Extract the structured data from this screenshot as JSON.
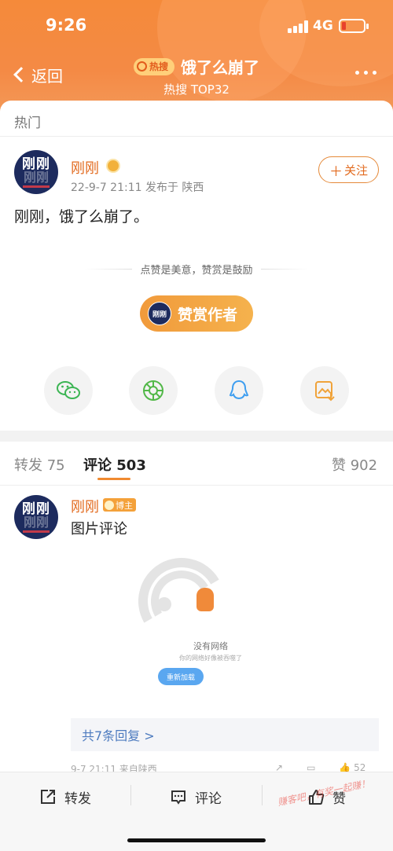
{
  "status_bar": {
    "time": "9:26",
    "network": "4G"
  },
  "nav": {
    "back_label": "返回",
    "hot_tag": "热搜",
    "title": "饿了么崩了",
    "subtitle": "热搜 TOP32"
  },
  "post": {
    "section_label": "热门",
    "avatar_text": "刚刚",
    "author": "刚刚",
    "meta": "22-9-7 21:11  发布于 陕西",
    "follow_label": "关注",
    "content": "刚刚，饿了么崩了。",
    "reward_hint": "点赞是美意，赞赏是鼓励",
    "reward_button": "赞赏作者",
    "share_icons": [
      "wechat-icon",
      "moments-icon",
      "qq-icon",
      "save-image-icon"
    ]
  },
  "tabs": {
    "repost": {
      "label": "转发",
      "count": "75"
    },
    "comment": {
      "label": "评论",
      "count": "503"
    },
    "like": {
      "label": "赞",
      "count": "902"
    }
  },
  "comment": {
    "avatar_text": "刚刚",
    "author": "刚刚",
    "badge": "博主",
    "text": "图片评论",
    "image": {
      "no_network": "没有网络",
      "no_network_sub": "你的网络好像被吞噬了",
      "reload": "重新加载"
    },
    "replies": "共7条回复 >",
    "meta": "9-7 21:11  来自陕西",
    "like_count": "52"
  },
  "bottom_bar": {
    "repost": "转发",
    "comment": "评论",
    "like": "赞"
  },
  "watermark": "赚客吧，有奖一起赚！",
  "colors": {
    "accent": "#f08a30",
    "name": "#e26a1e",
    "link": "#4d7bbf"
  }
}
